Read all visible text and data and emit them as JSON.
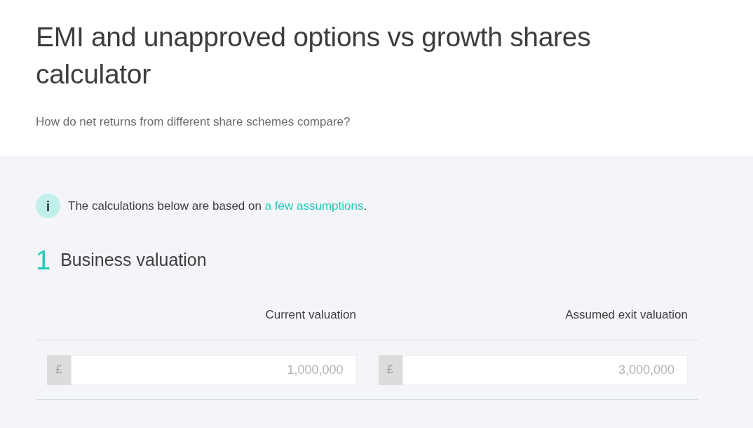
{
  "header": {
    "title": "EMI and unapproved options vs growth shares calculator",
    "subtitle": "How do net returns from different share schemes compare?"
  },
  "info": {
    "icon": "i",
    "text_before": "The calculations below are based on ",
    "link": "a few assumptions",
    "text_after": "."
  },
  "section": {
    "number": "1",
    "title": "Business valuation",
    "fields": [
      {
        "label": "Current valuation",
        "prefix": "£",
        "placeholder": "1,000,000"
      },
      {
        "label": "Assumed exit valuation",
        "prefix": "£",
        "placeholder": "3,000,000"
      }
    ]
  }
}
